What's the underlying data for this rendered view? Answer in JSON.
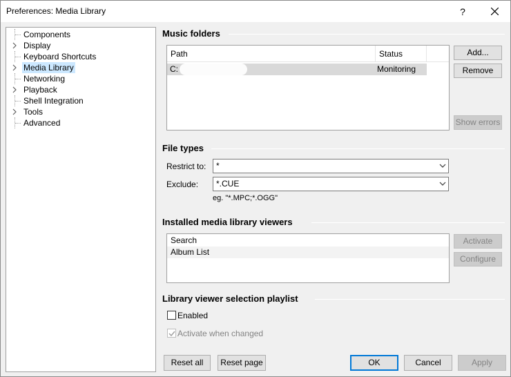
{
  "window": {
    "title": "Preferences: Media Library",
    "help_glyph": "?",
    "close_icon": "close-icon"
  },
  "tree": [
    {
      "label": "Components",
      "expandable": false
    },
    {
      "label": "Display",
      "expandable": true
    },
    {
      "label": "Keyboard Shortcuts",
      "expandable": false
    },
    {
      "label": "Media Library",
      "expandable": true,
      "selected": true
    },
    {
      "label": "Networking",
      "expandable": false
    },
    {
      "label": "Playback",
      "expandable": true
    },
    {
      "label": "Shell Integration",
      "expandable": false
    },
    {
      "label": "Tools",
      "expandable": true
    },
    {
      "label": "Advanced",
      "expandable": false
    }
  ],
  "music_folders": {
    "title": "Music folders",
    "columns": [
      "Path",
      "Status"
    ],
    "rows": [
      {
        "path": "C:",
        "status": "Monitoring"
      }
    ],
    "add_label": "Add...",
    "remove_label": "Remove",
    "show_errors_label": "Show errors"
  },
  "file_types": {
    "title": "File types",
    "restrict_label": "Restrict to:",
    "restrict_value": "*",
    "exclude_label": "Exclude:",
    "exclude_value": "*.CUE",
    "example": "eg. \"*.MPC;*.OGG\""
  },
  "viewers": {
    "title": "Installed media library viewers",
    "items": [
      "Search",
      "Album List"
    ],
    "activate_label": "Activate",
    "configure_label": "Configure"
  },
  "playlist": {
    "title": "Library viewer selection playlist",
    "enabled_label": "Enabled",
    "enabled_checked": false,
    "activate_when_changed_label": "Activate when changed",
    "activate_when_changed_checked": true
  },
  "footer": {
    "reset_all": "Reset all",
    "reset_page": "Reset page",
    "ok": "OK",
    "cancel": "Cancel",
    "apply": "Apply"
  },
  "colors": {
    "selection": "#cce8ff",
    "accent": "#0078d7"
  }
}
